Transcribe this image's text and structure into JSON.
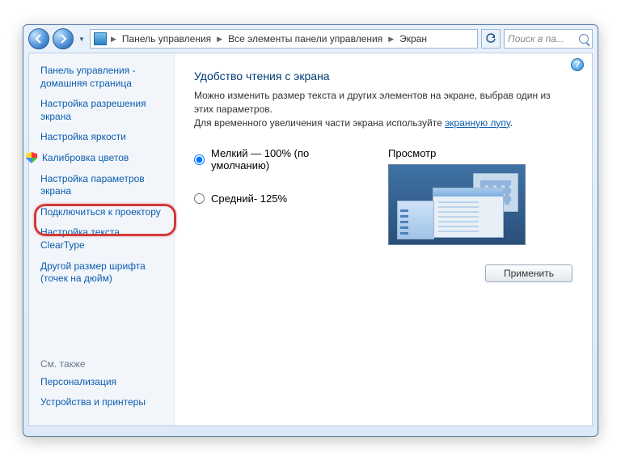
{
  "breadcrumb": {
    "part1": "Панель управления",
    "part2": "Все элементы панели управления",
    "part3": "Экран"
  },
  "search": {
    "placeholder": "Поиск в па..."
  },
  "sidebar": {
    "home": "Панель управления - домашняя страница",
    "links": [
      "Настройка разрешения экрана",
      "Настройка яркости",
      "Калибровка цветов",
      "Настройка параметров экрана",
      "Подключиться к проектору",
      "Настройка текста ClearType",
      "Другой размер шрифта (точек на дюйм)"
    ],
    "see_also_title": "См. также",
    "see_also": [
      "Персонализация",
      "Устройства и принтеры"
    ]
  },
  "main": {
    "title": "Удобство чтения с экрана",
    "desc1": "Можно изменить размер текста и других элементов на экране, выбрав один из этих параметров.",
    "desc2_prefix": "Для временного увеличения части экрана используйте ",
    "desc2_link": "экранную лупу",
    "desc2_suffix": ".",
    "option_small": "Мелкий — 100% (по умолчанию)",
    "option_medium": "Средний- 125%",
    "preview_label": "Просмотр",
    "apply": "Применить"
  }
}
